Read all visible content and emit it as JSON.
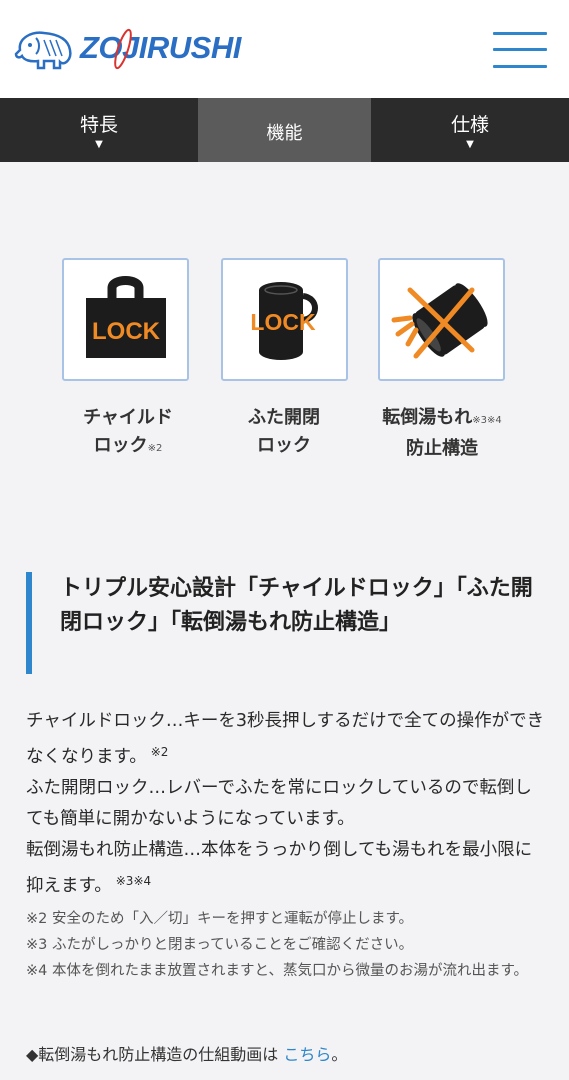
{
  "header": {
    "brand": "ZOJIRUSHI",
    "brand_color": "#2a6fc3",
    "menu_icon": "hamburger-icon"
  },
  "tabs": [
    {
      "label": "特長",
      "arrow": "▼",
      "active": false
    },
    {
      "label": "機能",
      "arrow": "",
      "active": true
    },
    {
      "label": "仕様",
      "arrow": "▼",
      "active": false
    }
  ],
  "features": [
    {
      "icon": "padlock-lock-icon",
      "icon_text": "LOCK",
      "line1": "チャイルド",
      "line2": "ロック",
      "note": "※2"
    },
    {
      "icon": "lid-lock-icon",
      "icon_text": "LOCK",
      "line1": "ふた開閉",
      "line2": "ロック",
      "note": ""
    },
    {
      "icon": "tip-over-spill-icon",
      "icon_text": "",
      "line1": "転倒湯もれ",
      "line1_note": "※3※4",
      "line2": "防止構造",
      "note": ""
    }
  ],
  "section": {
    "heading": "トリプル安心設計「チャイルドロック」「ふた開閉ロック」「転倒湯もれ防止構造」",
    "paragraphs": [
      {
        "text": "チャイルドロック…キーを3秒長押しするだけで全ての操作ができなくなります。",
        "note": "※2"
      },
      {
        "text": "ふた開閉ロック…レバーでふたを常にロックしているので転倒しても簡単に開かないようになっています。",
        "note": ""
      },
      {
        "text": "転倒湯もれ防止構造…本体をうっかり倒しても湯もれを最小限に抑えます。",
        "note": "※3※4"
      }
    ],
    "notes": [
      "※2 安全のため「入／切」キーを押すと運転が停止します。",
      "※3 ふたがしっかりと閉まっていることをご確認ください。",
      "※4 本体を倒れたまま放置されますと、蒸気口から微量のお湯が流れ出ます。"
    ],
    "video_prefix": "◆転倒湯もれ防止構造の仕組動画は ",
    "video_link": "こちら",
    "video_suffix": "。"
  },
  "colors": {
    "accent": "#2e86cc",
    "icon_orange": "#f08a24",
    "tab_bar": "#2b2b2b",
    "tab_active": "#5b5b5b"
  }
}
